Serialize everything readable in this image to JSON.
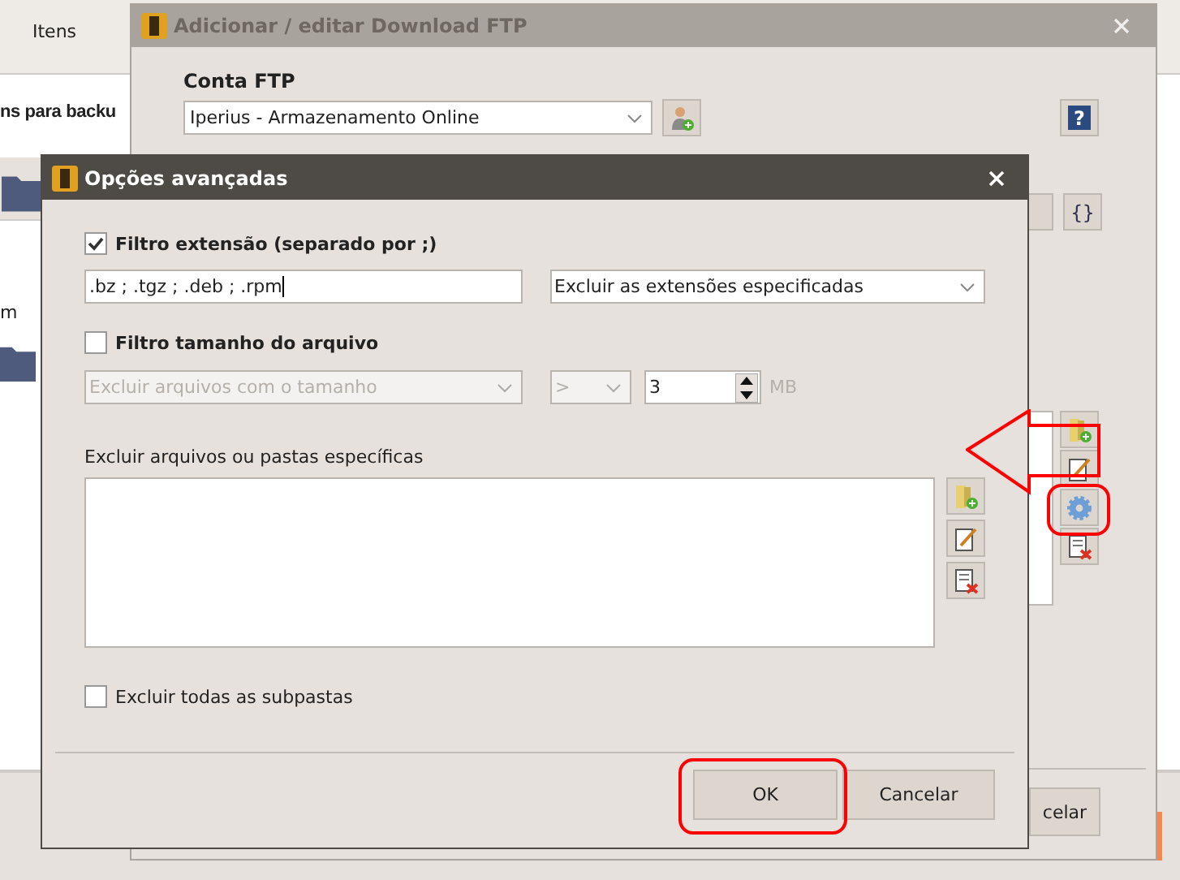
{
  "background_app": {
    "tab": "Itens",
    "heading": "ns para backu",
    "column_label": "m"
  },
  "ftp_dialog": {
    "title": "Adicionar / editar Download FTP",
    "account_label": "Conta FTP",
    "account_value": "Iperius - Armazenamento Online",
    "help_button": "?",
    "variables_button": "{}",
    "cancel_button": "celar"
  },
  "advanced_dialog": {
    "title": "Opções avançadas",
    "extension_filter": {
      "label": "Filtro extensão (separado por ;)",
      "checked": true,
      "value": ".bz ; .tgz ; .deb ; .rpm",
      "mode": "Excluir as extensões especificadas"
    },
    "size_filter": {
      "label": "Filtro tamanho do arquivo",
      "checked": false,
      "mode": "Excluir arquivos com o tamanho",
      "operator": ">",
      "value": "3",
      "unit": "MB"
    },
    "exclude_label": "Excluir arquivos ou pastas específicas",
    "exclude_subfolders": {
      "label": "Excluir todas as subpastas",
      "checked": false
    },
    "buttons": [
      "OK",
      "Cancelar"
    ]
  }
}
